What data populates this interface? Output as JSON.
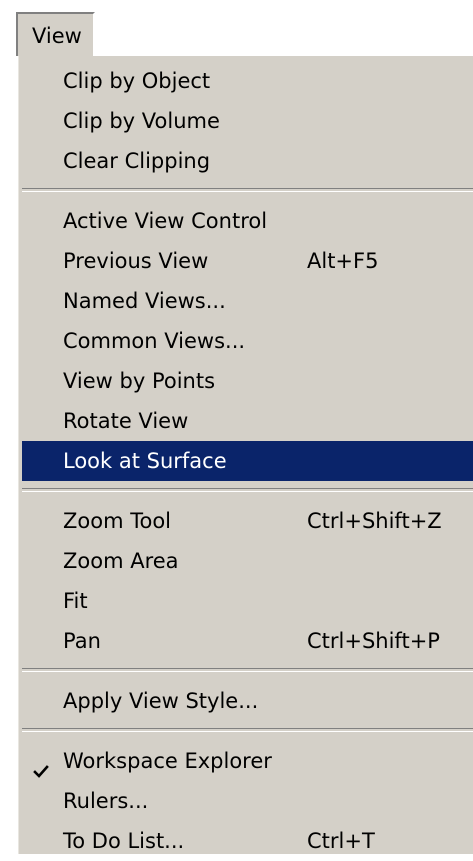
{
  "menubar": {
    "view_label": "View"
  },
  "menu": {
    "items": [
      {
        "label": "Clip by Object",
        "shortcut": ""
      },
      {
        "label": "Clip by Volume",
        "shortcut": ""
      },
      {
        "label": "Clear Clipping",
        "shortcut": ""
      },
      {
        "label": "Active View Control",
        "shortcut": ""
      },
      {
        "label": "Previous View",
        "shortcut": "Alt+F5"
      },
      {
        "label": "Named Views...",
        "shortcut": ""
      },
      {
        "label": "Common Views...",
        "shortcut": ""
      },
      {
        "label": "View by Points",
        "shortcut": ""
      },
      {
        "label": "Rotate View",
        "shortcut": ""
      },
      {
        "label": "Look at Surface",
        "shortcut": "",
        "selected": true
      },
      {
        "label": "Zoom Tool",
        "shortcut": "Ctrl+Shift+Z"
      },
      {
        "label": "Zoom Area",
        "shortcut": ""
      },
      {
        "label": "Fit",
        "shortcut": ""
      },
      {
        "label": "Pan",
        "shortcut": "Ctrl+Shift+P"
      },
      {
        "label": "Apply View Style...",
        "shortcut": ""
      },
      {
        "label": "Workspace Explorer",
        "shortcut": "",
        "checked": true,
        "icon": "checkmark-icon"
      },
      {
        "label": "Rulers...",
        "shortcut": ""
      },
      {
        "label": "To Do List...",
        "shortcut": "Ctrl+T"
      }
    ]
  },
  "colors": {
    "menu_background": "#d4d0c8",
    "highlight_background": "#0a246a",
    "highlight_text": "#ffffff",
    "text": "#000000"
  }
}
